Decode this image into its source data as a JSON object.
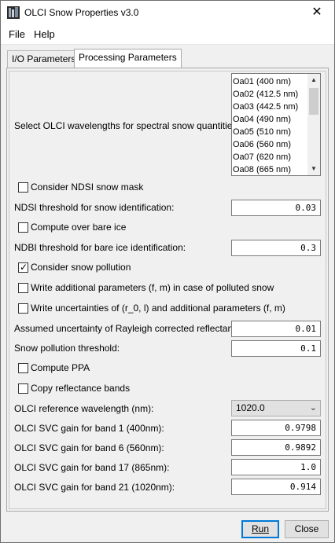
{
  "window": {
    "title": "OLCI Snow Properties v3.0",
    "close_glyph": "✕"
  },
  "menu": {
    "file": "File",
    "help": "Help"
  },
  "tabs": [
    {
      "label": "I/O Parameters",
      "active": false
    },
    {
      "label": "Processing Parameters",
      "active": true
    }
  ],
  "wavelengths": {
    "label": "Select OLCI wavelengths for spectral snow quantities:",
    "items": [
      "Oa01 (400 nm)",
      "Oa02 (412.5 nm)",
      "Oa03 (442.5 nm)",
      "Oa04 (490 nm)",
      "Oa05 (510 nm)",
      "Oa06 (560 nm)",
      "Oa07 (620 nm)",
      "Oa08 (665 nm)"
    ]
  },
  "ndsi_mask": {
    "label": "Consider NDSI snow mask",
    "checked": false
  },
  "ndsi_threshold": {
    "label": "NDSI threshold for snow identification:",
    "value": "0.03"
  },
  "bare_ice": {
    "label": "Compute over bare ice",
    "checked": false
  },
  "ndbi_threshold": {
    "label": "NDBI threshold for bare ice identification:",
    "value": "0.3"
  },
  "snow_pollution": {
    "label": "Consider snow pollution",
    "checked": true
  },
  "additional_params": {
    "label": "Write additional parameters (f, m) in case of polluted snow",
    "checked": false
  },
  "uncertainties": {
    "label": "Write uncertainties of (r_0, l) and additional parameters (f, m)",
    "checked": false
  },
  "rayleigh_uncertainty": {
    "label": "Assumed uncertainty of Rayleigh corrected reflectances:",
    "value": "0.01"
  },
  "pollution_threshold": {
    "label": "Snow pollution threshold:",
    "value": "0.1"
  },
  "compute_ppa": {
    "label": "Compute PPA",
    "checked": false
  },
  "copy_bands": {
    "label": "Copy reflectance bands",
    "checked": false
  },
  "ref_wavelength": {
    "label": "OLCI reference wavelength (nm):",
    "value": "1020.0"
  },
  "svc_1": {
    "label": "OLCI SVC gain for band 1 (400nm):",
    "value": "0.9798"
  },
  "svc_6": {
    "label": "OLCI SVC gain for band 6 (560nm):",
    "value": "0.9892"
  },
  "svc_17": {
    "label": "OLCI SVC gain for band 17 (865nm):",
    "value": "1.0"
  },
  "svc_21": {
    "label": "OLCI SVC gain for band 21 (1020nm):",
    "value": "0.914"
  },
  "buttons": {
    "run": "Run",
    "close": "Close"
  },
  "colors": {
    "accent": "#0078d7",
    "background": "#f0f0f0"
  }
}
